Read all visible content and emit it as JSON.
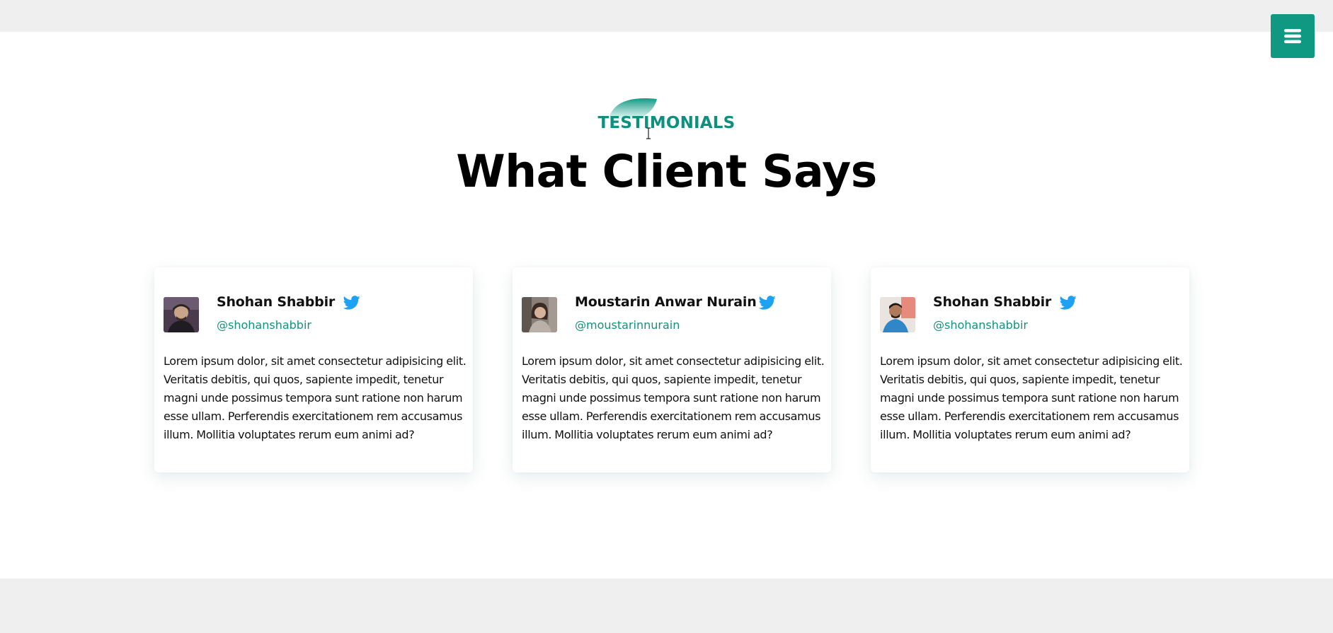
{
  "header": {
    "menu_icon": "hamburger-icon",
    "menu_color": "#0f9882"
  },
  "section": {
    "eyebrow": "TESTIMONIALS",
    "title": "What Client Says",
    "accent_color": "#0f8f7d"
  },
  "testimonials": [
    {
      "name": "Shohan Shabbir",
      "handle": "@shohanshabbir",
      "social_icon": "twitter-icon",
      "quote": "Lorem ipsum dolor, sit amet consectetur adipisicing elit. Veritatis debitis, qui quos, sapiente impedit, tenetur magni unde possimus tempora sunt ratione non harum esse ullam. Perferendis exercitationem rem accusamus illum. Mollitia voluptates rerum eum animi ad?"
    },
    {
      "name": "Moustarin Anwar Nurain",
      "handle": "@moustarinnurain",
      "social_icon": "twitter-icon",
      "quote": "Lorem ipsum dolor, sit amet consectetur adipisicing elit. Veritatis debitis, qui quos, sapiente impedit, tenetur magni unde possimus tempora sunt ratione non harum esse ullam. Perferendis exercitationem rem accusamus illum. Mollitia voluptates rerum eum animi ad?"
    },
    {
      "name": "Shohan Shabbir",
      "handle": "@shohanshabbir",
      "social_icon": "twitter-icon",
      "quote": "Lorem ipsum dolor, sit amet consectetur adipisicing elit. Veritatis debitis, qui quos, sapiente impedit, tenetur magni unde possimus tempora sunt ratione non harum esse ullam. Perferendis exercitationem rem accusamus illum. Mollitia voluptates rerum eum animi ad?"
    }
  ],
  "colors": {
    "twitter": "#1da1f2",
    "handle": "#15917e"
  }
}
